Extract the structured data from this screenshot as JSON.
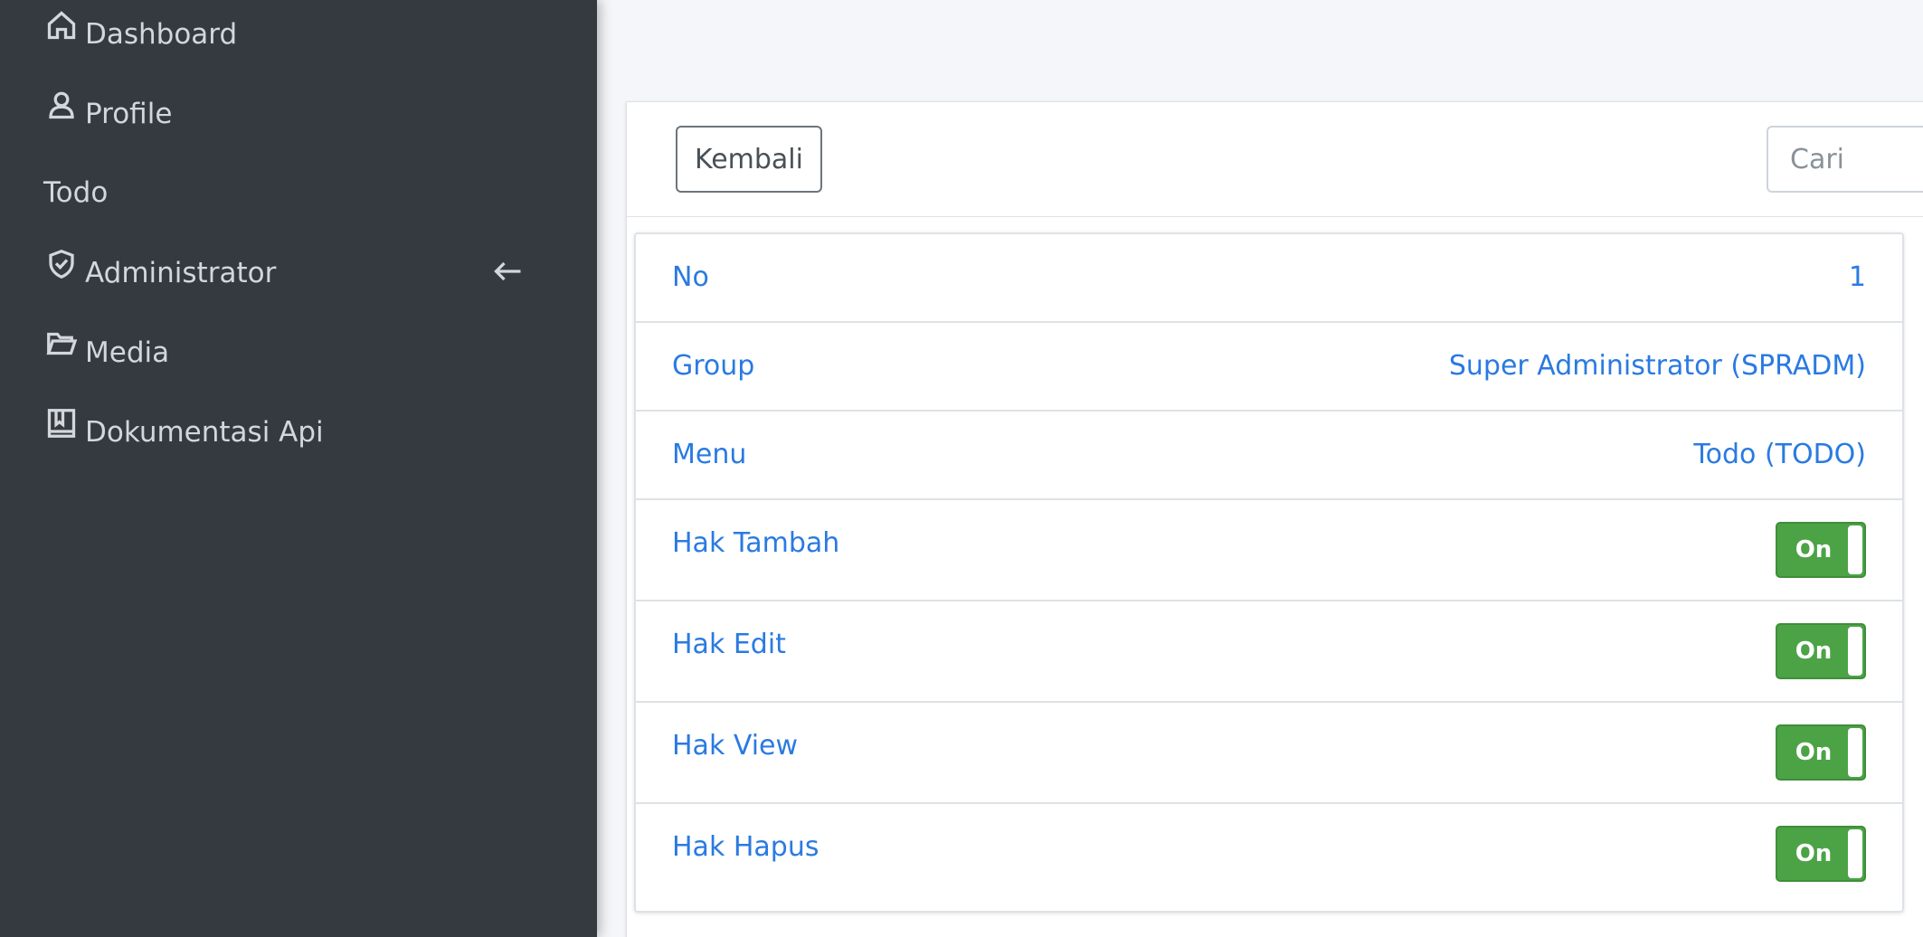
{
  "sidebar": {
    "items": [
      {
        "label": "Dashboard",
        "icon": "home-icon"
      },
      {
        "label": "Profile",
        "icon": "person-icon"
      },
      {
        "label": "Todo",
        "icon": ""
      },
      {
        "label": "Administrator",
        "icon": "shield-check-icon",
        "expand_icon": "arrow-left-icon"
      },
      {
        "label": "Media",
        "icon": "folder-icon"
      },
      {
        "label": "Dokumentasi Api",
        "icon": "book-icon"
      }
    ]
  },
  "toolbar": {
    "back_label": "Kembali",
    "search_placeholder": "Cari"
  },
  "detail": {
    "rows": [
      {
        "label": "No",
        "value": "1"
      },
      {
        "label": "Group",
        "value": "Super Administrator (SPRADM)"
      },
      {
        "label": "Menu",
        "value": "Todo (TODO)"
      },
      {
        "label": "Hak Tambah",
        "toggle": "On"
      },
      {
        "label": "Hak Edit",
        "toggle": "On"
      },
      {
        "label": "Hak View",
        "toggle": "On"
      },
      {
        "label": "Hak Hapus",
        "toggle": "On"
      }
    ]
  },
  "colors": {
    "sidebar_bg": "#343a40",
    "link": "#2a7ae2",
    "toggle_on": "#4ca346"
  }
}
